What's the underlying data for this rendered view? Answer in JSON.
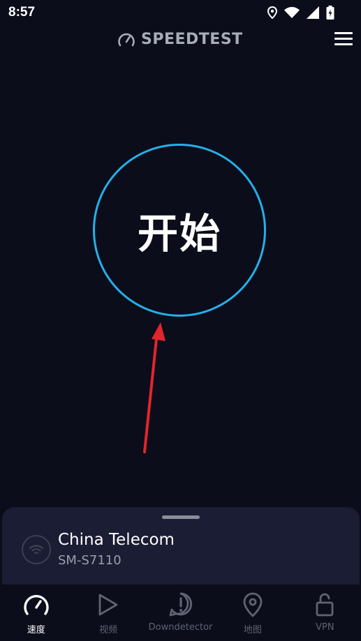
{
  "status_bar": {
    "time": "8:57"
  },
  "header": {
    "brand": "SPEEDTEST"
  },
  "main": {
    "start_label": "开始"
  },
  "provider": {
    "name": "China Telecom",
    "device": "SM-S7110"
  },
  "nav": {
    "items": [
      {
        "label": "速度",
        "icon": "speedometer-icon",
        "active": true
      },
      {
        "label": "视频",
        "icon": "play-icon"
      },
      {
        "label": "Downdetector",
        "icon": "alert-icon"
      },
      {
        "label": "地图",
        "icon": "map-pin-icon"
      },
      {
        "label": "VPN",
        "icon": "unlock-icon"
      }
    ]
  },
  "colors": {
    "accent": "#24b0e8",
    "background": "#0b0d1b",
    "panel": "#1a1d33",
    "arrow": "#e0262b"
  }
}
